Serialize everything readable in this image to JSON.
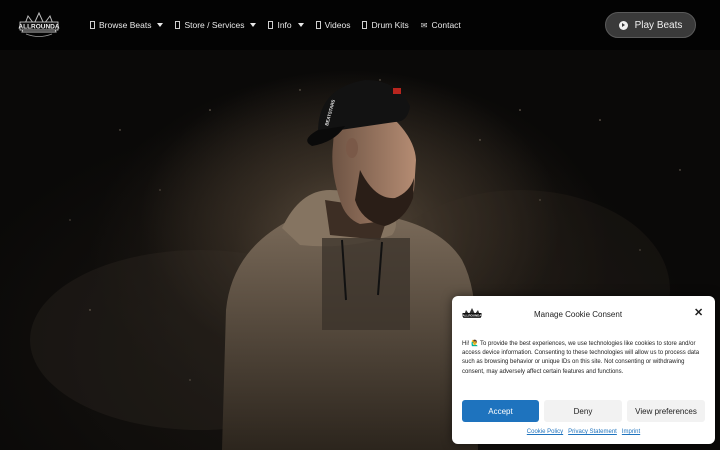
{
  "header": {
    "logo_alt": "ALLROUNDA",
    "nav": [
      {
        "label": "Browse Beats",
        "dropdown": true,
        "icon": "file-icon"
      },
      {
        "label": "Store / Services",
        "dropdown": true,
        "icon": "file-icon"
      },
      {
        "label": "Info",
        "dropdown": true,
        "icon": "file-icon"
      },
      {
        "label": "Videos",
        "dropdown": false,
        "icon": "file-icon"
      },
      {
        "label": "Drum Kits",
        "dropdown": false,
        "icon": "file-icon"
      },
      {
        "label": "Contact",
        "dropdown": false,
        "icon": "envelope-icon"
      }
    ],
    "play_button": "Play Beats"
  },
  "hero": {
    "cap_text": "BEATSTARS"
  },
  "cookie": {
    "title": "Manage Cookie Consent ",
    "close": "✕",
    "body": "Hi! 🙋‍♂️ To provide the best experiences, we use technologies like cookies to store and/or access device information. Consenting to these technologies will allow us to process data such as browsing behavior or unique IDs on this site. Not consenting or withdrawing consent, may adversely affect certain features and functions.",
    "accept": "Accept",
    "deny": "Deny",
    "preferences": "View preferences",
    "links": [
      "Cookie Policy",
      "Privacy Statement",
      "Imprint"
    ]
  },
  "colors": {
    "accent": "#1e73be",
    "header_bg": "#030303",
    "play_button_bg": "#3a3a3a"
  }
}
